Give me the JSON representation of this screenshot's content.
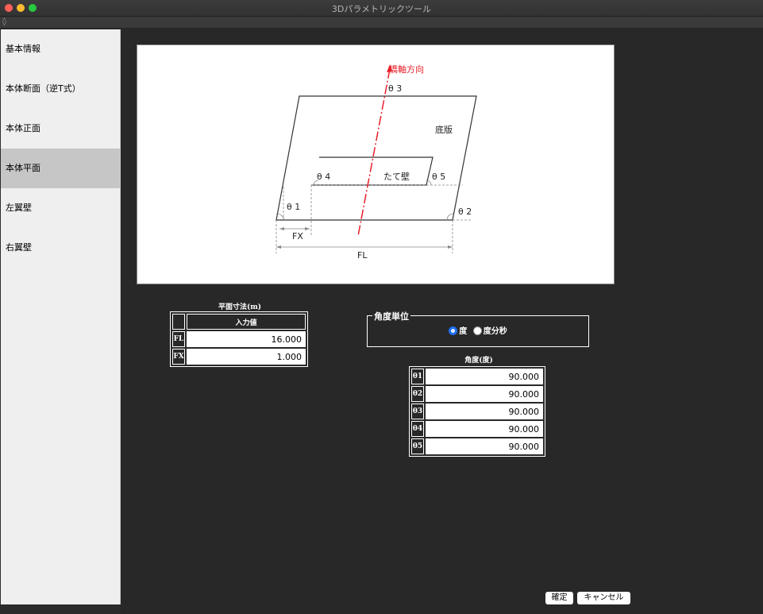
{
  "window": {
    "title": "3Dパラメトリックツール"
  },
  "sidebar": {
    "items": [
      {
        "label": "基本情報"
      },
      {
        "label": "本体断面（逆T式）"
      },
      {
        "label": "本体正面"
      },
      {
        "label": "本体平面"
      },
      {
        "label": "左翼壁"
      },
      {
        "label": "右翼壁"
      }
    ],
    "active_index": 3
  },
  "diagram": {
    "bridge_axis": "橋軸方向",
    "theta1": "θ 1",
    "theta2": "θ 2",
    "theta3": "θ 3",
    "theta4": "θ 4",
    "theta5": "θ 5",
    "bottom_slab": "底版",
    "wall": "たて壁",
    "fx": "FX",
    "fl": "FL",
    "axis_color": "#e8202a"
  },
  "plan_dimensions": {
    "caption": "平面寸法(m)",
    "header": "入力値",
    "rows": [
      {
        "label": "FL",
        "value": "16.000"
      },
      {
        "label": "FX",
        "value": "1.000"
      }
    ]
  },
  "angle_unit": {
    "legend": "角度単位",
    "options": [
      {
        "label": "度",
        "selected": true
      },
      {
        "label": "度分秒",
        "selected": false
      }
    ]
  },
  "angles": {
    "caption": "角度(度)",
    "rows": [
      {
        "label": "θ1",
        "value": "90.000"
      },
      {
        "label": "θ2",
        "value": "90.000"
      },
      {
        "label": "θ3",
        "value": "90.000"
      },
      {
        "label": "θ4",
        "value": "90.000"
      },
      {
        "label": "θ5",
        "value": "90.000"
      }
    ]
  },
  "buttons": {
    "ok": "確定",
    "cancel": "キャンセル"
  }
}
